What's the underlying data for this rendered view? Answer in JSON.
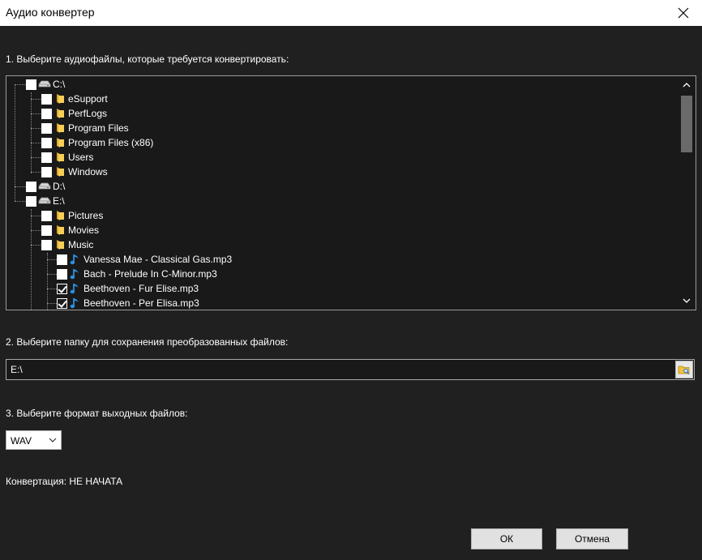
{
  "window": {
    "title": "Аудио конвертер"
  },
  "step1": {
    "label": "1. Выберите аудиофайлы, которые требуется конвертировать:"
  },
  "tree": {
    "nodes": [
      {
        "label": "C:\\",
        "icon": "drive-icon",
        "checked": false
      },
      {
        "label": "eSupport",
        "icon": "folder-icon",
        "checked": false
      },
      {
        "label": "PerfLogs",
        "icon": "folder-icon",
        "checked": false
      },
      {
        "label": "Program Files",
        "icon": "folder-icon",
        "checked": false
      },
      {
        "label": "Program Files (x86)",
        "icon": "folder-icon",
        "checked": false
      },
      {
        "label": "Users",
        "icon": "folder-icon",
        "checked": false
      },
      {
        "label": "Windows",
        "icon": "folder-icon",
        "checked": false
      },
      {
        "label": "D:\\",
        "icon": "drive-icon",
        "checked": false
      },
      {
        "label": "E:\\",
        "icon": "drive-icon",
        "checked": false
      },
      {
        "label": "Pictures",
        "icon": "folder-icon",
        "checked": false
      },
      {
        "label": "Movies",
        "icon": "folder-icon",
        "checked": false
      },
      {
        "label": "Music",
        "icon": "folder-icon",
        "checked": false
      },
      {
        "label": "Vanessa Mae - Classical Gas.mp3",
        "icon": "music-note-icon",
        "checked": false
      },
      {
        "label": "Bach - Prelude In C-Minor.mp3",
        "icon": "music-note-icon",
        "checked": false
      },
      {
        "label": "Beethoven - Fur Elise.mp3",
        "icon": "music-note-icon",
        "checked": true
      },
      {
        "label": "Beethoven - Per Elisa.mp3",
        "icon": "music-note-icon",
        "checked": true
      }
    ]
  },
  "step2": {
    "label": "2. Выберите папку для сохранения преобразованных файлов:",
    "path_value": "E:\\"
  },
  "step3": {
    "label": "3. Выберите формат выходных файлов:",
    "format_value": "WAV"
  },
  "status": {
    "text": "Конвертация: НЕ НАЧАТА"
  },
  "buttons": {
    "ok": "ОК",
    "cancel": "Отмена"
  },
  "colors": {
    "background": "#202020",
    "folder": "#f5c542",
    "note": "#2a8fe0"
  }
}
